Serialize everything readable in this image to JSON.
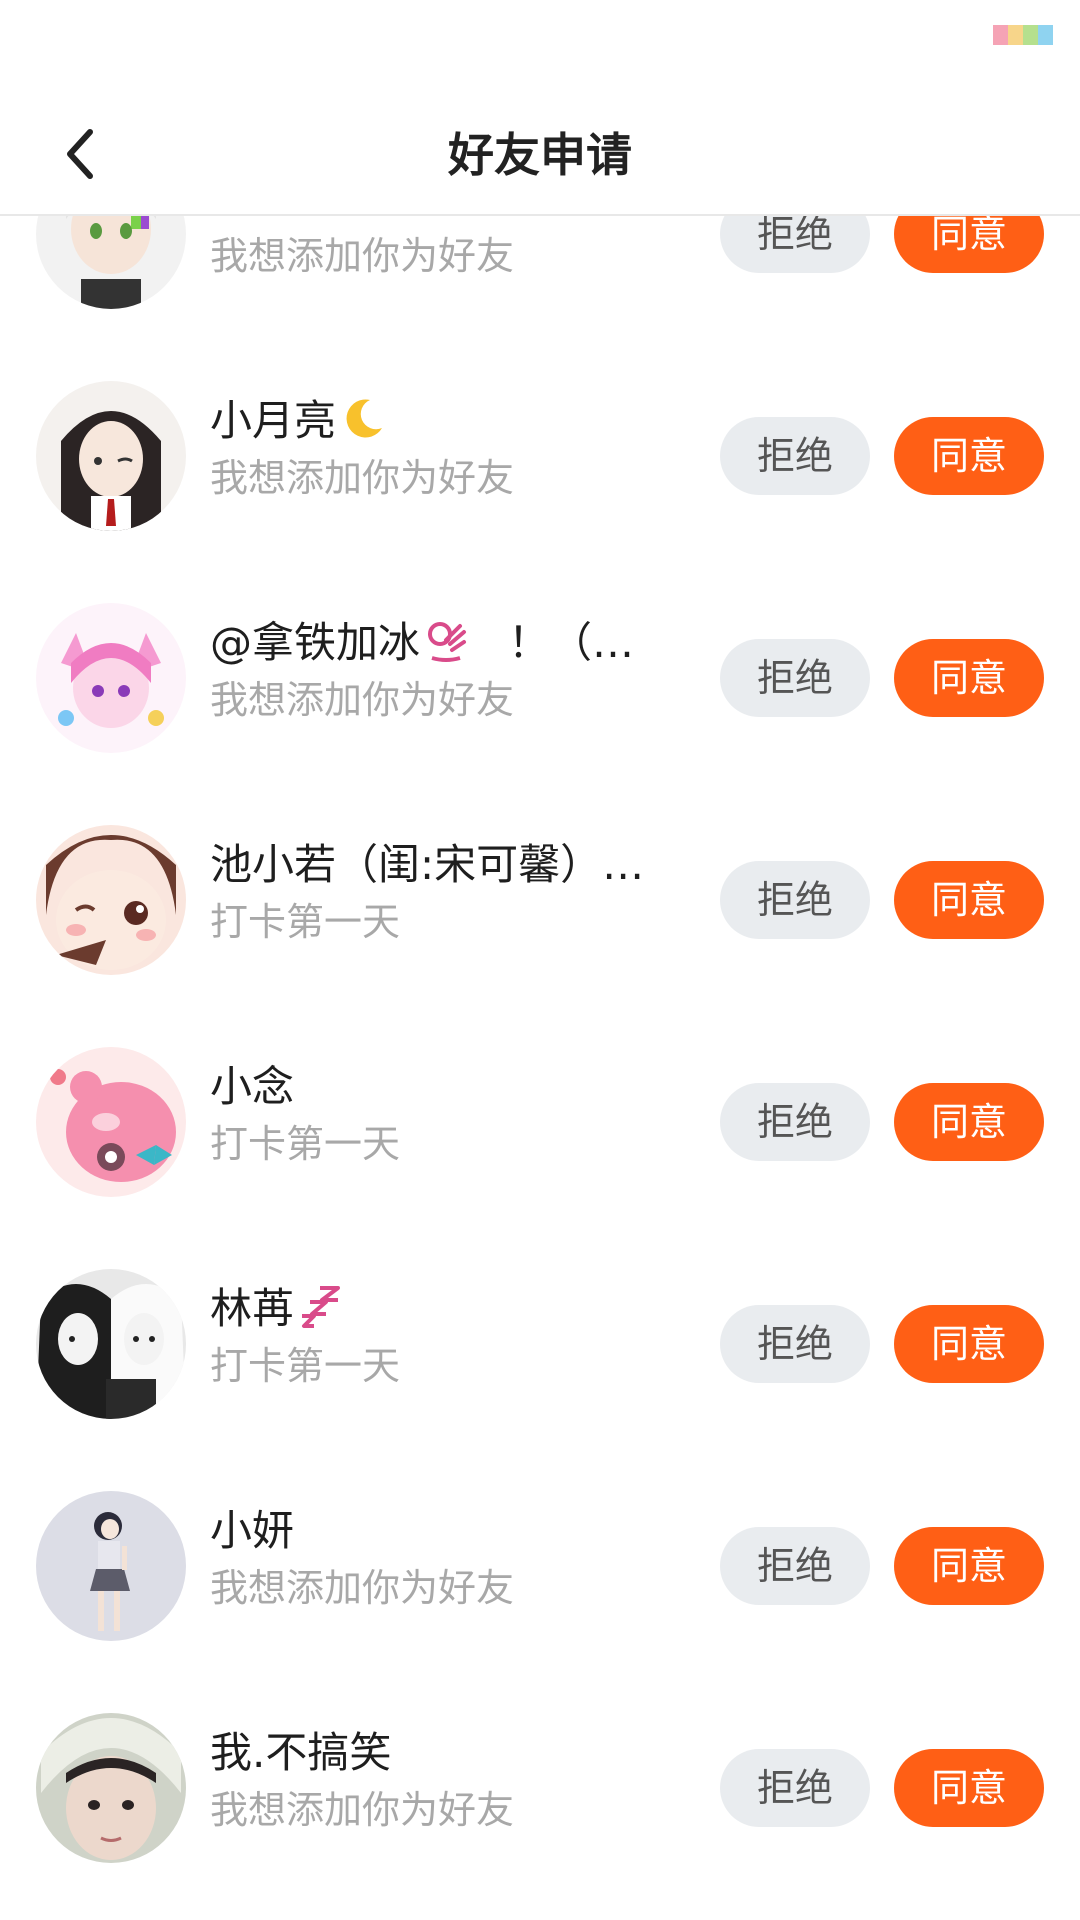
{
  "header": {
    "title": "好友申请",
    "back_icon": "chevron-left-icon"
  },
  "status_bar": {
    "battery_colors": [
      "#f5a3b5",
      "#f7d58a",
      "#b5e08e",
      "#8fd3f0"
    ]
  },
  "actions": {
    "reject_label": "拒绝",
    "accept_label": "同意"
  },
  "colors": {
    "accept": "#ff5f15",
    "reject_bg": "#e9ecef",
    "subtext": "#a8a8a8"
  },
  "requests": [
    {
      "name": "",
      "message": "我想添加你为好友"
    },
    {
      "name": "小月亮",
      "message": "我想添加你为好友",
      "emoji": "crescent-moon-icon"
    },
    {
      "name": "@拿铁加冰",
      "name_suffix": "！（…",
      "message": "我想添加你为好友",
      "emoji": "ok-hand-icon"
    },
    {
      "name": "池小若（闺:宋可馨）…",
      "message": "打卡第一天"
    },
    {
      "name": "小念",
      "message": "打卡第一天"
    },
    {
      "name": "林苒",
      "message": "打卡第一天",
      "emoji": "zzz-icon"
    },
    {
      "name": "小妍",
      "message": "我想添加你为好友"
    },
    {
      "name": "我.不搞笑",
      "message": "我想添加你为好友"
    }
  ]
}
